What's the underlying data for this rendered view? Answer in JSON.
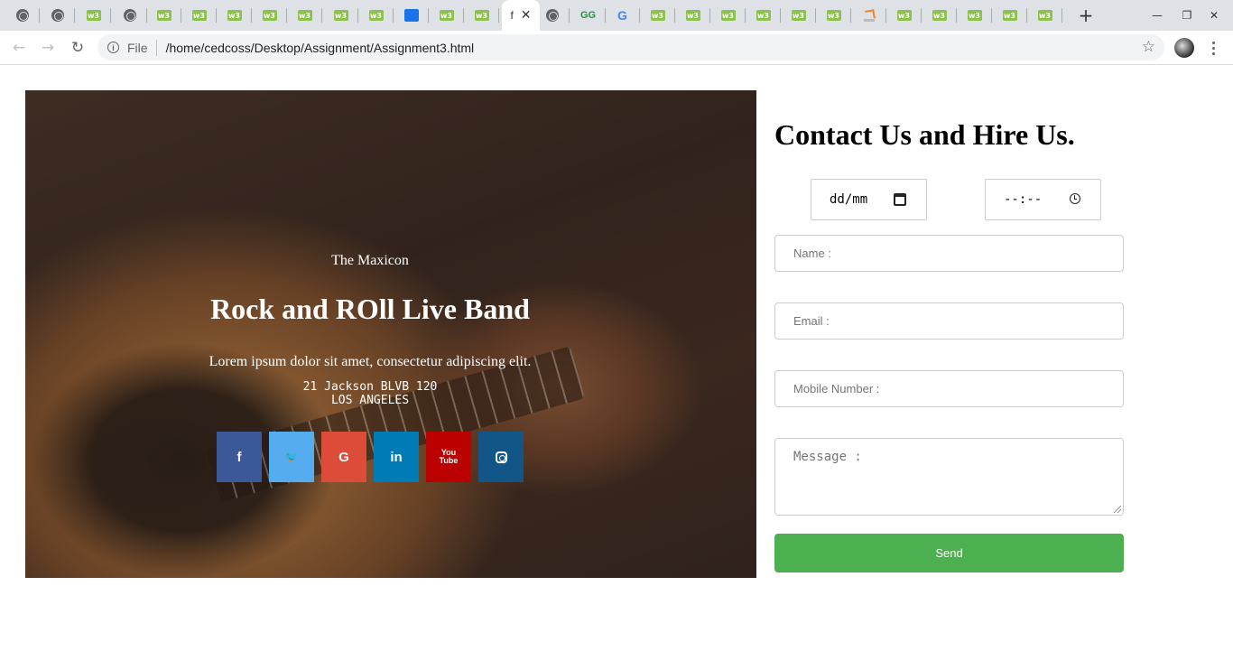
{
  "browser": {
    "tabs": [
      {
        "icon": "globe-icon"
      },
      {
        "icon": "globe-icon"
      },
      {
        "icon": "w3schools-icon"
      },
      {
        "icon": "globe-icon"
      },
      {
        "icon": "w3schools-icon"
      },
      {
        "icon": "w3schools-icon"
      },
      {
        "icon": "w3schools-icon"
      },
      {
        "icon": "w3schools-icon"
      },
      {
        "icon": "w3schools-icon"
      },
      {
        "icon": "w3schools-icon"
      },
      {
        "icon": "w3schools-icon"
      },
      {
        "icon": "contacts-icon"
      },
      {
        "icon": "w3schools-icon"
      },
      {
        "icon": "w3schools-icon"
      },
      {
        "icon": "active-tab",
        "title": "f",
        "close": "✕"
      },
      {
        "icon": "globe-icon"
      },
      {
        "icon": "geeksforgeeks-icon"
      },
      {
        "icon": "google-icon"
      },
      {
        "icon": "w3schools-icon"
      },
      {
        "icon": "w3schools-icon"
      },
      {
        "icon": "w3schools-icon"
      },
      {
        "icon": "w3schools-icon"
      },
      {
        "icon": "w3schools-icon"
      },
      {
        "icon": "w3schools-icon"
      },
      {
        "icon": "stackoverflow-icon"
      },
      {
        "icon": "w3schools-icon"
      },
      {
        "icon": "w3schools-icon"
      },
      {
        "icon": "w3schools-icon"
      },
      {
        "icon": "w3schools-icon"
      },
      {
        "icon": "w3schools-icon"
      }
    ],
    "w3_glyph": "w3",
    "google_glyph": "G",
    "gfg_glyph": "GG",
    "new_tab": "+",
    "minimize": "—",
    "restore": "❐",
    "close": "✕",
    "back": "←",
    "forward": "→",
    "reload": "↻",
    "info_glyph": "i",
    "scheme_label": "File",
    "url": "/home/cedcoss/Desktop/Assignment/Assignment3.html",
    "bookmark": "☆"
  },
  "hero": {
    "band_name": "The Maxicon",
    "title": "Rock and ROll Live Band",
    "description": "Lorem ipsum dolor sit amet, consectetur adipiscing elit.",
    "address_line1": "21 Jackson BLVB 120",
    "address_line2": "LOS ANGELES",
    "social": {
      "facebook": "f",
      "twitter": "🐦",
      "google": "G",
      "linkedin": "in",
      "youtube_line1": "You",
      "youtube_line2": "Tube"
    }
  },
  "contact": {
    "title": "Contact Us and Hire Us.",
    "date_value": "dd/mm",
    "time_value": "--:--",
    "name_placeholder": "Name :",
    "email_placeholder": "Email :",
    "mobile_placeholder": "Mobile Number :",
    "message_placeholder": "Message :",
    "send_label": "Send"
  },
  "colors": {
    "send": "#4caf50",
    "facebook": "#3b5998",
    "twitter": "#55acee",
    "google": "#dd4b39",
    "linkedin": "#007bb5",
    "youtube": "#bb0000",
    "instagram": "#125688"
  }
}
